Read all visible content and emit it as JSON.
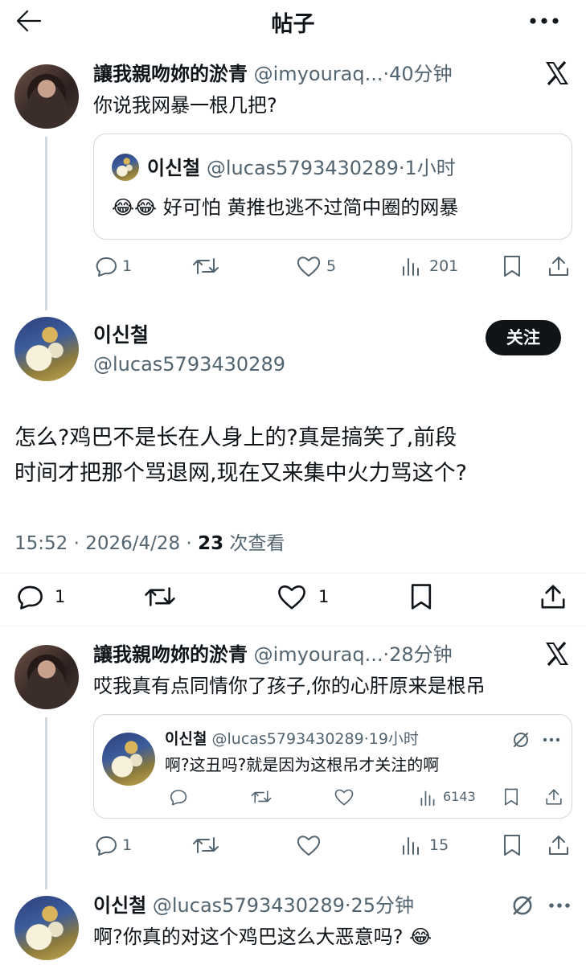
{
  "header": {
    "title": "帖子",
    "back_icon": "arrow-left-icon",
    "more_icon": "more-horizontal-icon"
  },
  "post1": {
    "author_name": "讓我親吻妳的淤青",
    "author_handle": "@imyouraq...",
    "time": "·40分钟",
    "text": "你说我网暴一根几把?",
    "quote": {
      "author_name": "이신철",
      "author_handle": "@lucas5793430289",
      "time": "·1小时",
      "emoji": "😂😂",
      "text": "好可怕 黄推也逃不过简中圈的网暴"
    },
    "actions": {
      "replies": "1",
      "retweets": "",
      "likes": "5",
      "views": "201"
    }
  },
  "main_post": {
    "author_name": "이신철",
    "author_handle": "@lucas5793430289",
    "follow_label": "关注",
    "text_line1": "怎么?鸡巴不是长在人身上的?真是搞笑了,前段",
    "text_line2": "时间才把那个骂退网,现在又来集中火力骂这个?",
    "meta_time": "15:52 · 2026/4/28 · ",
    "meta_views": "23",
    "meta_views_label": " 次查看",
    "actions": {
      "replies": "1",
      "likes": "1"
    }
  },
  "post2": {
    "author_name": "讓我親吻妳的淤青",
    "author_handle": "@imyouraq...",
    "time": "·28分钟",
    "text": "哎我真有点同情你了孩子,你的心肝原来是根吊",
    "quote": {
      "author_name": "이신철",
      "author_handle": "@lucas5793430289",
      "time": "·19小时",
      "text": "啊?这丑吗?就是因为这根吊才关注的啊",
      "views": "6143"
    },
    "actions": {
      "replies": "1",
      "views": "15"
    }
  },
  "post3": {
    "author_name": "이신철",
    "author_handle": "@lucas5793430289",
    "time": "·25分钟",
    "text": "啊?你真的对这个鸡巴这么大恶意吗?",
    "emoji": "😂"
  },
  "colors": {
    "text": "#0f1419",
    "secondary": "#536471",
    "border": "#cfd9de"
  }
}
